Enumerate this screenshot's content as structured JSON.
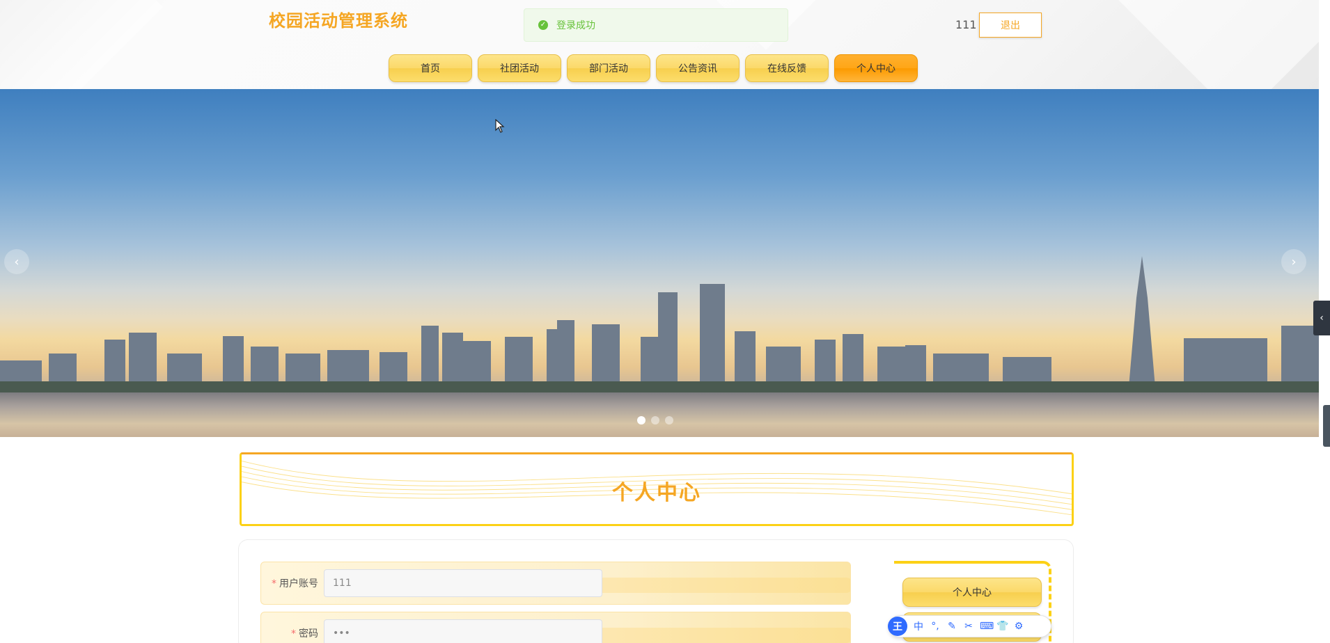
{
  "header": {
    "site_title": "校园活动管理系统",
    "toast_message": "登录成功",
    "username": "111",
    "logout_label": "退出",
    "nav": [
      {
        "label": "首页"
      },
      {
        "label": "社团活动"
      },
      {
        "label": "部门活动"
      },
      {
        "label": "公告资讯"
      },
      {
        "label": "在线反馈"
      },
      {
        "label": "个人中心",
        "active": true
      }
    ]
  },
  "banner": {
    "prev_icon": "‹",
    "next_icon": "›",
    "slides": 3,
    "active_slide": 1
  },
  "section": {
    "title": "个人中心"
  },
  "form": {
    "fields": [
      {
        "label": "用户账号",
        "required_mark": "*",
        "value": "111"
      },
      {
        "label": "密码",
        "required_mark": "*",
        "value": "•••"
      }
    ]
  },
  "side_menu": {
    "items": [
      {
        "label": "个人中心"
      },
      {
        "label": ""
      }
    ]
  },
  "ime_toolbar": {
    "logo": "王",
    "items": [
      "中",
      "°,",
      "✎",
      "✂",
      "⌨",
      "👕",
      "⚙"
    ]
  },
  "side_tab_icon": "‹",
  "colors": {
    "accent": "#f5a623",
    "nav_yellow": "#fcd96a",
    "success": "#67c23a"
  }
}
